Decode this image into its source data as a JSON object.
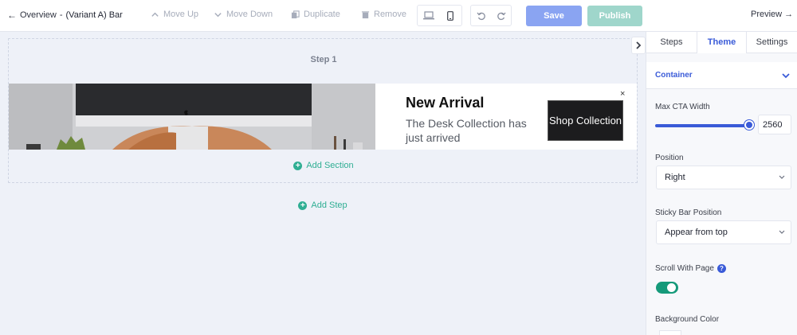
{
  "header": {
    "back_arrow": "←",
    "overview": "Overview",
    "separator": "-",
    "variant": "(Variant A) Bar",
    "toolbar": [
      {
        "label": "Move Up",
        "icon": "chevron-up-icon"
      },
      {
        "label": "Move Down",
        "icon": "chevron-down-icon"
      },
      {
        "label": "Duplicate",
        "icon": "copy-icon"
      },
      {
        "label": "Remove",
        "icon": "trash-icon"
      }
    ],
    "save": "Save",
    "publish": "Publish",
    "preview": "Preview →"
  },
  "canvas": {
    "step_title": "Step 1",
    "bar": {
      "headline": "New Arrival",
      "subline": "The Desk Collection has just arrived",
      "cta": "Shop Collection",
      "close": "×"
    },
    "add_section": "Add Section",
    "add_step": "Add Step"
  },
  "panel": {
    "tabs": [
      "Steps",
      "Theme",
      "Settings"
    ],
    "active_tab": "Theme",
    "section": "Container",
    "max_cta_width_label": "Max CTA Width",
    "max_cta_width_value": "2560",
    "max_cta_width_fraction": 0.96,
    "position_label": "Position",
    "position_value": "Right",
    "sticky_label": "Sticky Bar Position",
    "sticky_value": "Appear from top",
    "scroll_label": "Scroll With Page",
    "scroll_help": "?",
    "scroll_on": true,
    "bg_label": "Background Color"
  },
  "colors": {
    "accent": "#3a5bd8",
    "save": "#8aa4f2",
    "publish": "#9fd6cb",
    "add": "#2fae93",
    "toggle": "#169a7a"
  }
}
